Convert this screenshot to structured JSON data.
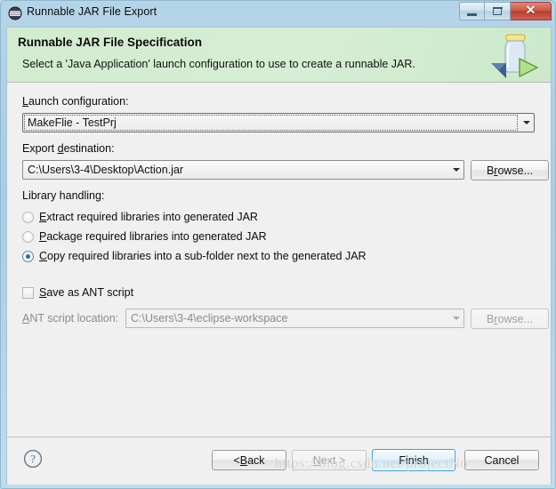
{
  "window": {
    "title": "Runnable JAR File Export",
    "app_icon": "eclipse-icon",
    "controls": {
      "minimize": "minimize-icon",
      "maximize": "restore-icon",
      "close": "✕"
    }
  },
  "header": {
    "title": "Runnable JAR File Specification",
    "description": "Select a 'Java Application' launch configuration to use to create a runnable JAR.",
    "icon": "runnable-jar-icon",
    "background_color": "#d3edd1"
  },
  "launch_configuration": {
    "label_prefix": "L",
    "label_rest": "aunch configuration:",
    "value": "MakeFlie - TestPrj",
    "focused": true
  },
  "export_destination": {
    "label_prefix": "Export ",
    "label_mnemonic": "d",
    "label_rest": "estination:",
    "value": "C:\\Users\\3-4\\Desktop\\Action.jar",
    "browse_prefix": "B",
    "browse_mnemonic": "r",
    "browse_rest": "owse..."
  },
  "library_handling": {
    "label": "Library handling:",
    "options": [
      {
        "mnemonic": "E",
        "rest": "xtract required libraries into generated JAR",
        "checked": false
      },
      {
        "mnemonic": "P",
        "rest": "ackage required libraries into generated JAR",
        "checked": false
      },
      {
        "mnemonic": "C",
        "rest": "opy required libraries into a sub-folder next to the generated JAR",
        "checked": true
      }
    ]
  },
  "ant_script": {
    "checkbox_mnemonic": "S",
    "checkbox_rest": "ave as ANT script",
    "checked": false,
    "location_label_mnemonic": "A",
    "location_label_rest": "NT script location:",
    "location_value": "C:\\Users\\3-4\\eclipse-workspace",
    "browse_prefix": "B",
    "browse_mnemonic": "r",
    "browse_rest": "owse...",
    "disabled": true
  },
  "footer": {
    "help_icon": "help-icon",
    "buttons": [
      {
        "name": "back",
        "prefix": "< ",
        "mnemonic": "B",
        "rest": "ack",
        "disabled": false,
        "default": false
      },
      {
        "name": "next",
        "prefix": "",
        "mnemonic": "N",
        "rest": "ext >",
        "disabled": true,
        "default": false
      },
      {
        "name": "finish",
        "prefix": "Finish",
        "mnemonic": "",
        "rest": "",
        "disabled": false,
        "default": true
      },
      {
        "name": "cancel",
        "prefix": "Cancel",
        "mnemonic": "",
        "rest": "",
        "disabled": false,
        "default": false
      }
    ]
  },
  "watermark": {
    "text": "https://blog.csdn.net/projectNo"
  },
  "colors": {
    "accent": "#3c9ad6",
    "header_green": "#d3edd1",
    "frame_blue": "#b5d4e8",
    "close_red": "#c0392b"
  }
}
